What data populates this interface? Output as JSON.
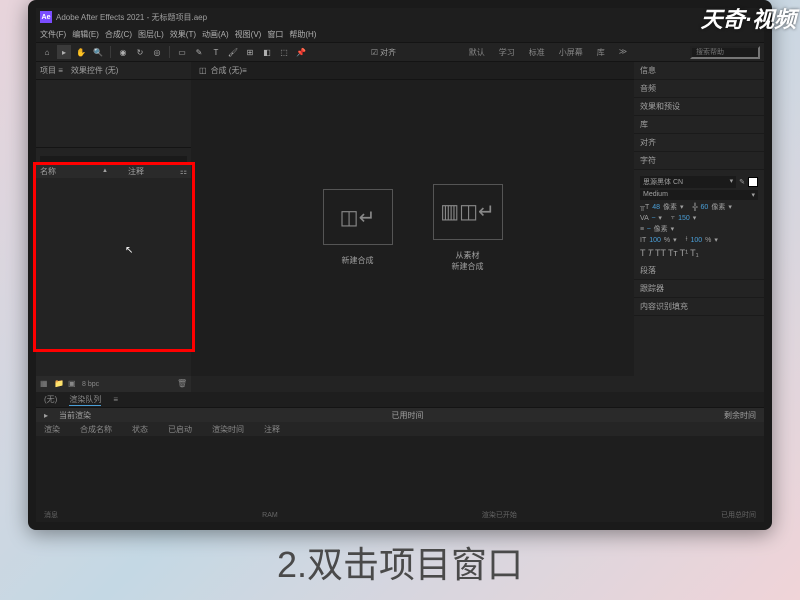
{
  "watermark": "天奇·视频",
  "caption": "2.双击项目窗口",
  "titlebar": {
    "app_icon": "Ae",
    "title": "Adobe After Effects 2021 - 无标题项目.aep"
  },
  "menu": {
    "file": "文件(F)",
    "edit": "编辑(E)",
    "comp": "合成(C)",
    "layer": "图层(L)",
    "effect": "效果(T)",
    "anim": "动画(A)",
    "view": "视图(V)",
    "window": "窗口",
    "help": "帮助(H)"
  },
  "toolbar": {
    "align_check": "对齐",
    "default": "默认",
    "learn": "学习",
    "standard": "标准",
    "small": "小屏幕",
    "lib": "库",
    "search_btn": "≫",
    "search_ph": "搜索帮助"
  },
  "project": {
    "tab1": "项目",
    "tab2": "效果控件 (无)",
    "search_ph": "",
    "col_name": "名称",
    "col_comment": "注释",
    "footer_bpc": "8 bpc"
  },
  "composition": {
    "tab_prefix": "合成 (无)",
    "new_comp": "新建合成",
    "from_footage": "从素材\n新建合成"
  },
  "right": {
    "info": "信息",
    "audio": "音频",
    "fx": "效果和预设",
    "lib": "库",
    "align": "对齐",
    "char": "字符",
    "font": "思源黑体 CN",
    "weight": "Medium",
    "size": "48",
    "size_unit": "像素",
    "leading": "60",
    "leading_unit": "像素",
    "kern": "VA",
    "kern_val": "",
    "tracking": "150",
    "stroke": "",
    "stroke_unit": "像素",
    "vscale": "100",
    "vscale_unit": "%",
    "hscale": "100",
    "hscale_unit": "%",
    "para": "段落",
    "tracker": "跟踪器",
    "content": "内容识别填充"
  },
  "bottom": {
    "tab1": "(无)",
    "tab2": "渲染队列",
    "hdr_current": "当前渲染",
    "hdr_elapsed": "已用时间",
    "hdr_remain": "剩余时间",
    "col_render": "渲染",
    "col_name": "合成名称",
    "col_status": "状态",
    "col_started": "已启动",
    "col_rtime": "渲染时间",
    "col_comment": "注释",
    "ft_msg": "消息",
    "ft_ram": "RAM",
    "ft_rstart": "渲染已开始",
    "ft_total": "已用总时间"
  }
}
